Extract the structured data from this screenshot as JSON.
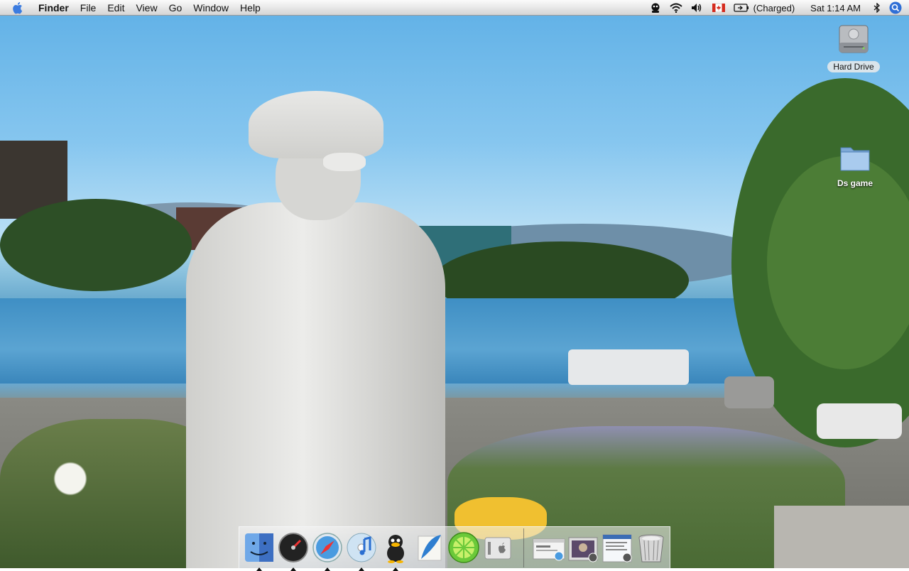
{
  "menubar": {
    "app_name": "Finder",
    "menus": [
      "File",
      "Edit",
      "View",
      "Go",
      "Window",
      "Help"
    ],
    "status_icons": [
      "caution-sign-icon",
      "wifi-icon",
      "volume-icon",
      "canada-flag-icon",
      "battery-icon"
    ],
    "battery_status": "(Charged)",
    "clock": "Sat 1:14 AM",
    "extra_icons": [
      "bluetooth-icon",
      "spotlight-icon"
    ]
  },
  "desktop": {
    "icons": [
      {
        "label": "Hard Drive",
        "icon": "hard-drive-icon"
      },
      {
        "label": "Ds game",
        "icon": "folder-icon"
      }
    ]
  },
  "dock": {
    "apps": [
      {
        "icon": "finder-icon",
        "running": true
      },
      {
        "icon": "dashboard-icon",
        "running": true
      },
      {
        "icon": "safari-icon",
        "running": true
      },
      {
        "icon": "itunes-icon",
        "running": true
      },
      {
        "icon": "adium-duck-icon",
        "running": true
      },
      {
        "icon": "feather-icon",
        "running": false
      },
      {
        "icon": "limewire-icon",
        "running": false
      },
      {
        "icon": "system-preferences-icon",
        "running": false
      }
    ],
    "docked_items": [
      {
        "icon": "minimized-window-icon"
      },
      {
        "icon": "minimized-photo-window-icon"
      },
      {
        "icon": "minimized-document-window-icon"
      },
      {
        "icon": "trash-icon"
      }
    ]
  },
  "colors": {
    "menubar_top": "#fbfbfb",
    "menubar_bottom": "#d4d4d4",
    "spotlight_blue": "#2f6fd6"
  }
}
